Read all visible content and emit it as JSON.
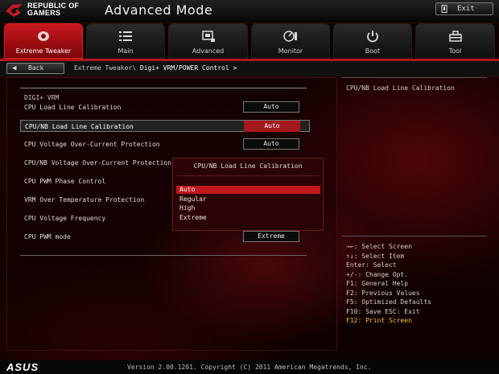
{
  "header": {
    "brand_line1": "REPUBLIC OF",
    "brand_line2": "GAMERS",
    "title": "Advanced Mode",
    "exit_label": "Exit"
  },
  "tabs": [
    {
      "label": "Extreme Tweaker",
      "icon": "rog-eye-icon",
      "active": true
    },
    {
      "label": "Main",
      "icon": "list-icon",
      "active": false
    },
    {
      "label": "Advanced",
      "icon": "chip-icon",
      "active": false
    },
    {
      "label": "Monitor",
      "icon": "monitor-gauge-icon",
      "active": false
    },
    {
      "label": "Boot",
      "icon": "power-icon",
      "active": false
    },
    {
      "label": "Tool",
      "icon": "toolbox-icon",
      "active": false
    }
  ],
  "nav": {
    "back_label": "Back",
    "breadcrumb_prefix": "Extreme Tweaker\\",
    "breadcrumb_current": "Digi+ VRM/POWER Control >"
  },
  "main": {
    "group_label": "DIGI+ VRM",
    "items": [
      {
        "label": "CPU Load Line Calibration",
        "value": "Auto"
      },
      {
        "label": "CPU/NB Load Line Calibration",
        "value": "Auto",
        "selected": true
      },
      {
        "label": "CPU Voltage Over-Current Protection",
        "value": "Auto"
      },
      {
        "label": "CPU/NB Voltage Over-Current Protection",
        "value": ""
      },
      {
        "label": "CPU PWM Phase Control",
        "value": ""
      },
      {
        "label": "VRM Over Temperature Protection",
        "value": ""
      },
      {
        "label": "CPU Voltage Frequency",
        "value": ""
      },
      {
        "label": "CPU PWM mode",
        "value": "Extreme"
      }
    ]
  },
  "popup": {
    "title": "CPU/NB Load Line Calibration",
    "options": [
      "Auto",
      "Regular",
      "High",
      "Extreme"
    ],
    "selected": "Auto"
  },
  "help": {
    "title": "CPU/NB Load Line Calibration",
    "keys": [
      "→←: Select Screen",
      "↑↓: Select Item",
      "Enter: Select",
      "+/-: Change Opt.",
      "F1: General Help",
      "F2: Previous Values",
      "F5: Optimized Defaults",
      "F10: Save  ESC: Exit"
    ],
    "key_highlight": "F12: Print Screen"
  },
  "footer": {
    "logo_text": "ASUS",
    "version": "Version 2.00.1201. Copyright (C) 2011 American Megatrends, Inc."
  },
  "colors": {
    "accent": "#c0181c",
    "highlight": "#f3c12e"
  }
}
